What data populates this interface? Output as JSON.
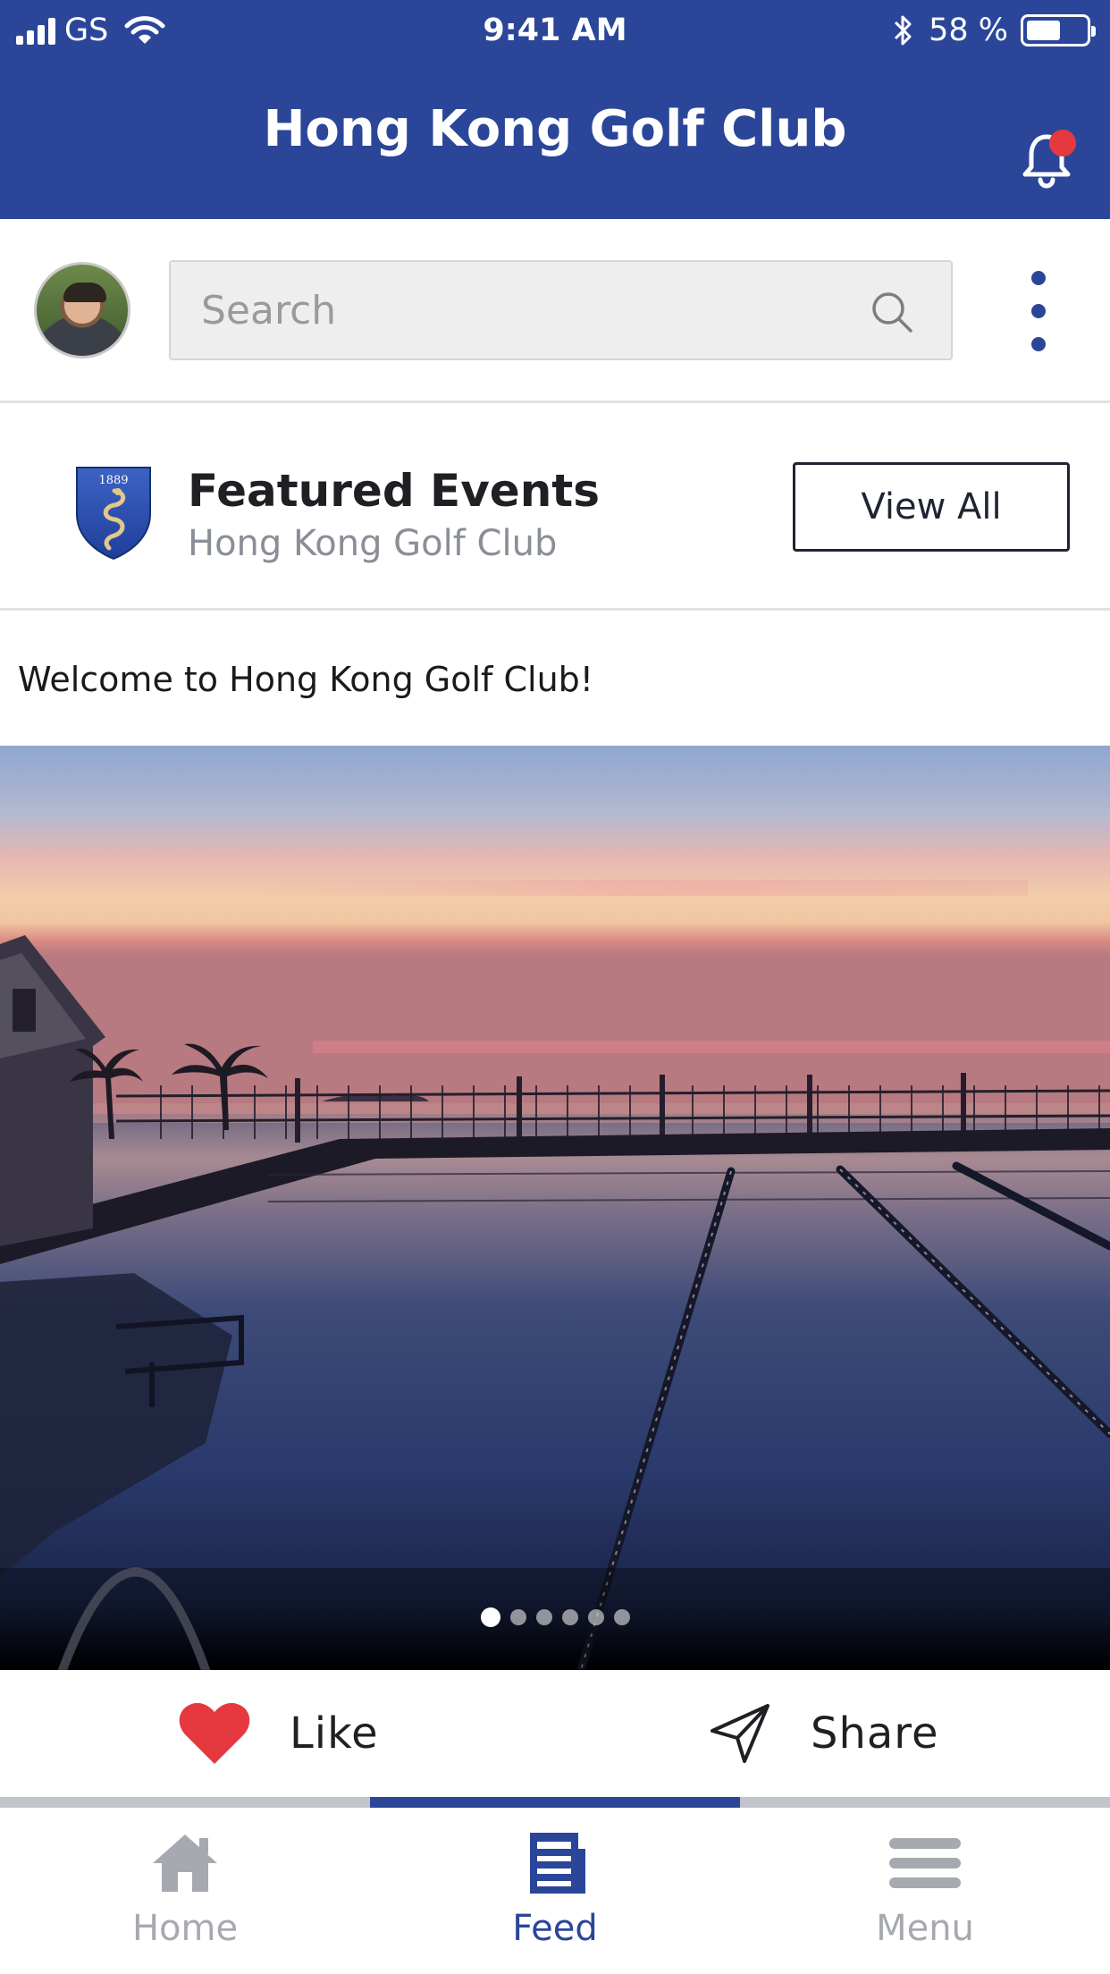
{
  "status_bar": {
    "carrier": "GS",
    "time": "9:41 AM",
    "battery_percent": "58 %",
    "battery_level": 0.58
  },
  "header": {
    "title": "Hong Kong Golf Club",
    "notification_icon": "bell-icon",
    "has_unread": true,
    "color": "#2b4699",
    "badge_color": "#e5393f"
  },
  "search": {
    "placeholder": "Search",
    "value": ""
  },
  "featured": {
    "title": "Featured Events",
    "subtitle": "Hong Kong Golf Club",
    "view_all_label": "View All",
    "logo_year": "1889"
  },
  "post": {
    "text": "Welcome to Hong Kong Golf Club!",
    "carousel": {
      "total": 6,
      "active_index": 0
    }
  },
  "actions": {
    "like_label": "Like",
    "share_label": "Share",
    "like_color": "#e5393f"
  },
  "tabs": [
    {
      "label": "Home",
      "icon": "home-icon",
      "active": false
    },
    {
      "label": "Feed",
      "icon": "newspaper-icon",
      "active": true
    },
    {
      "label": "Menu",
      "icon": "menu-icon",
      "active": false
    }
  ]
}
